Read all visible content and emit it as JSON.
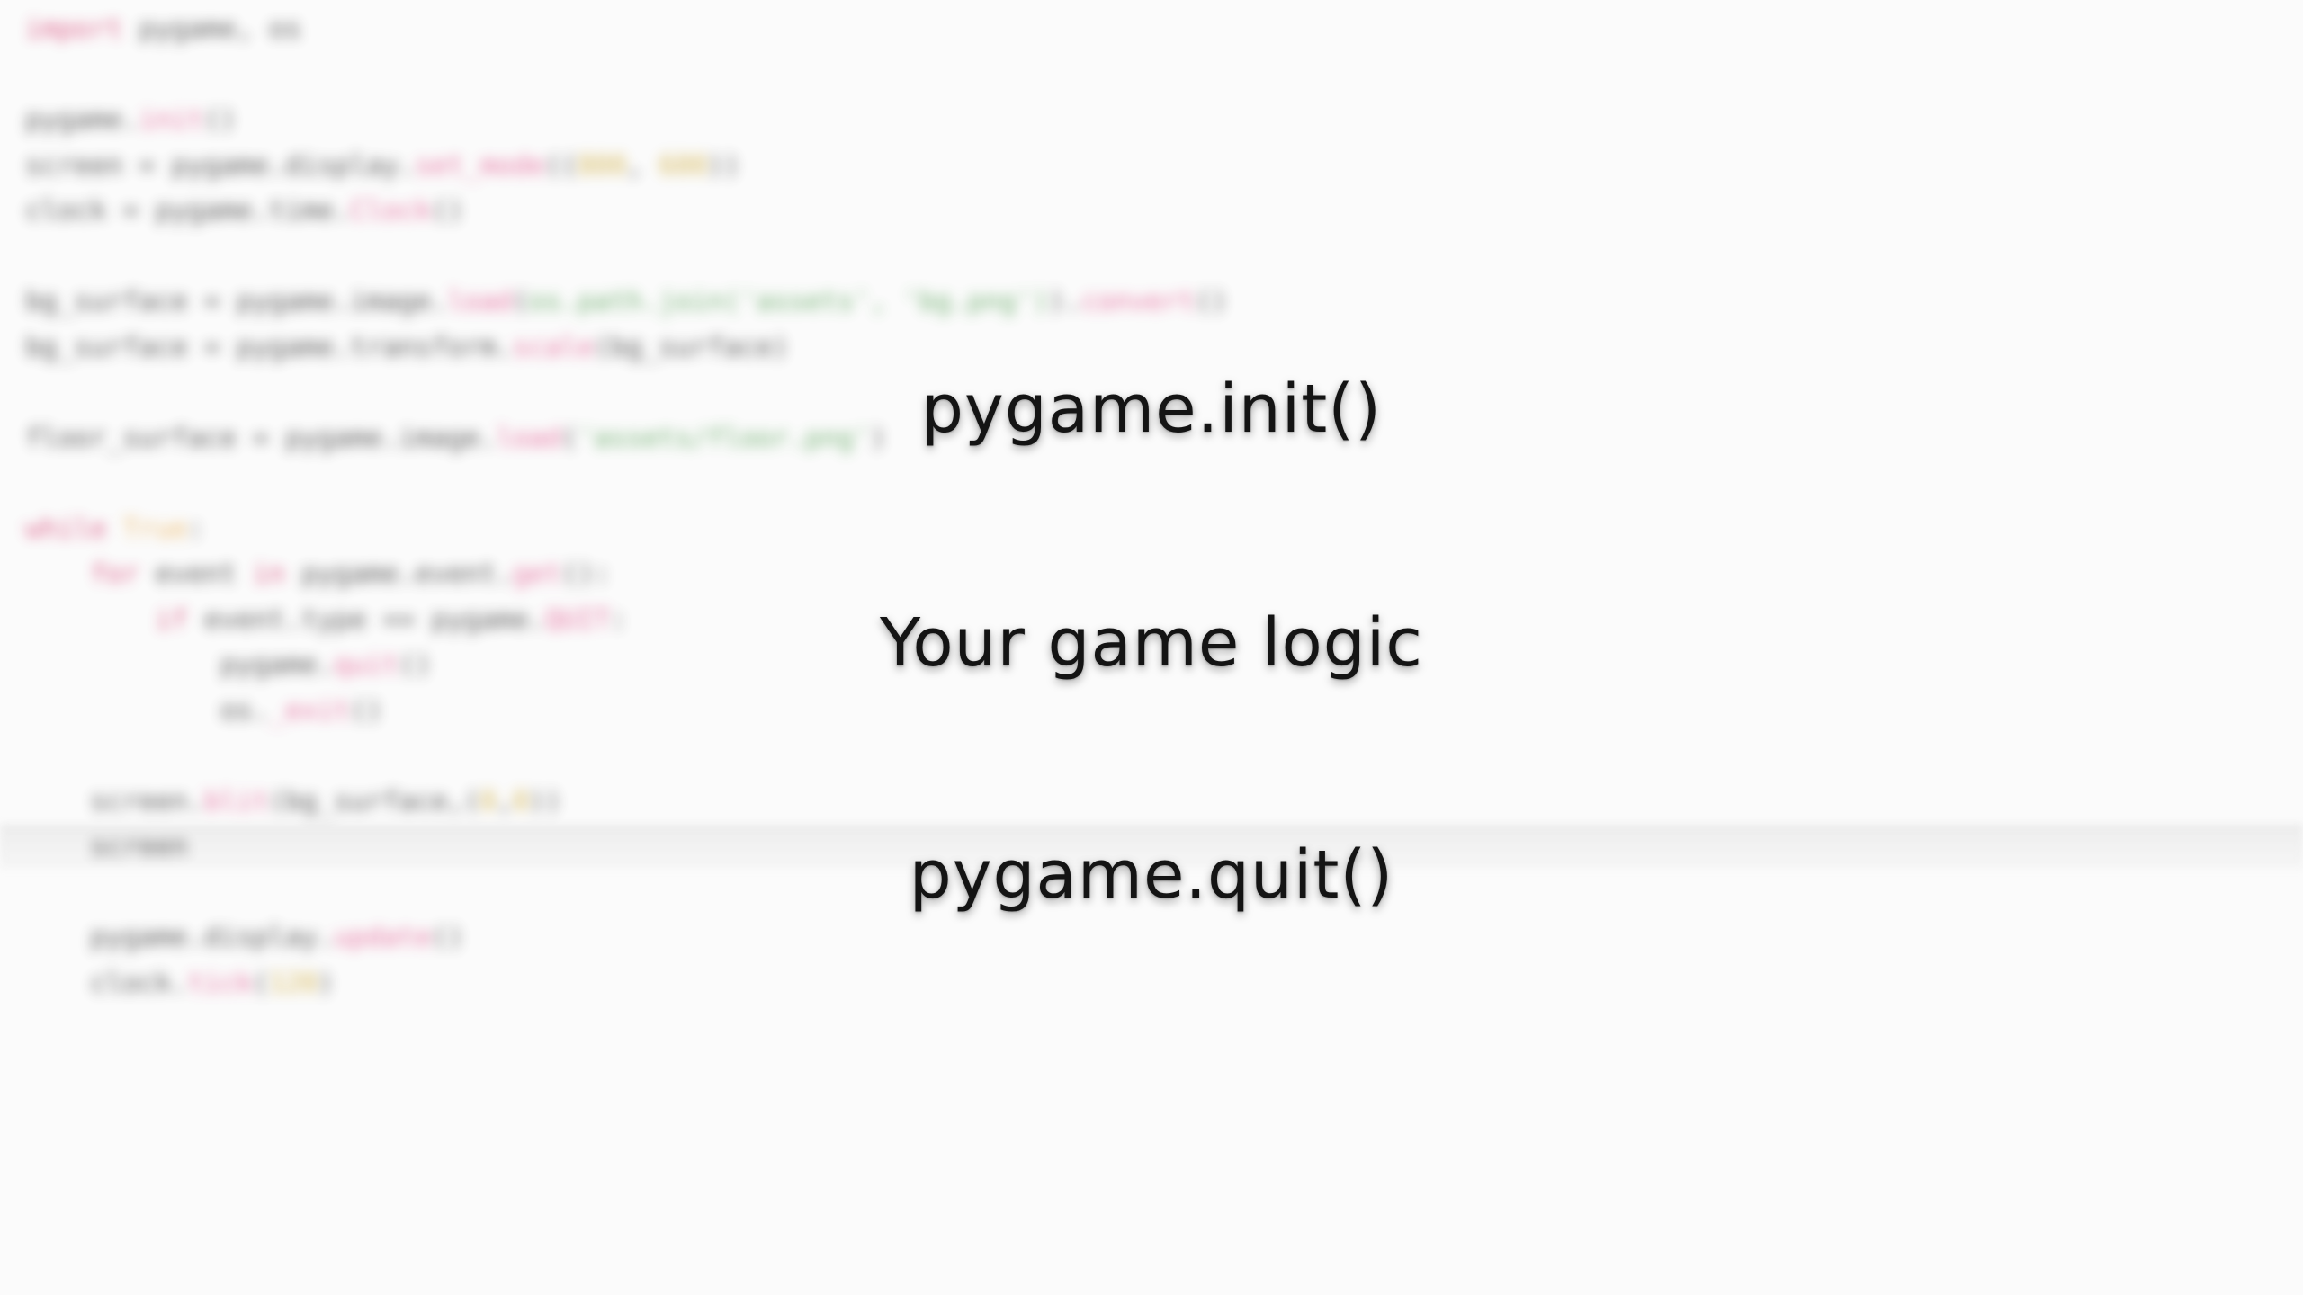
{
  "editor": {
    "lines": [
      [
        {
          "t": "import ",
          "c": "kw"
        },
        {
          "t": "pygame",
          "c": "fn"
        },
        {
          "t": ", os",
          "c": "fn"
        }
      ],
      [],
      [
        {
          "t": "pygame.",
          "c": "fn"
        },
        {
          "t": "init",
          "c": "pink"
        },
        {
          "t": "()",
          "c": "fn"
        }
      ],
      [
        {
          "t": "screen = pygame.display.",
          "c": "fn"
        },
        {
          "t": "set_mode",
          "c": "pink"
        },
        {
          "t": "((",
          "c": "fn"
        },
        {
          "t": "800",
          "c": "num"
        },
        {
          "t": ", ",
          "c": "fn"
        },
        {
          "t": "600",
          "c": "num"
        },
        {
          "t": "))",
          "c": "fn"
        }
      ],
      [
        {
          "t": "clock = pygame.time.",
          "c": "fn"
        },
        {
          "t": "Clock",
          "c": "pink"
        },
        {
          "t": "()",
          "c": "fn"
        }
      ],
      [],
      [
        {
          "t": "bg_surface = pygame.image.",
          "c": "fn"
        },
        {
          "t": "load",
          "c": "pink"
        },
        {
          "t": "(",
          "c": "fn"
        },
        {
          "t": "os.path.join('assets', 'bg.png')",
          "c": "str"
        },
        {
          "t": ").",
          "c": "fn"
        },
        {
          "t": "convert",
          "c": "pink"
        },
        {
          "t": "()",
          "c": "fn"
        }
      ],
      [
        {
          "t": "bg_surface = pygame.transform.",
          "c": "fn"
        },
        {
          "t": "scale",
          "c": "pink"
        },
        {
          "t": "(bg_surface)",
          "c": "fn"
        }
      ],
      [],
      [
        {
          "t": "floor_surface = pygame.image.",
          "c": "fn"
        },
        {
          "t": "load",
          "c": "pink"
        },
        {
          "t": "(",
          "c": "fn"
        },
        {
          "t": "'assets/floor.png'",
          "c": "str"
        },
        {
          "t": ")",
          "c": "fn"
        }
      ],
      [],
      [
        {
          "t": "while ",
          "c": "kw"
        },
        {
          "t": "True",
          "c": "orange"
        },
        {
          "t": ":",
          "c": "fn"
        }
      ],
      [
        {
          "t": "    for ",
          "c": "kw"
        },
        {
          "t": "event ",
          "c": "fn"
        },
        {
          "t": "in ",
          "c": "kw"
        },
        {
          "t": "pygame.event.",
          "c": "fn"
        },
        {
          "t": "get",
          "c": "pink"
        },
        {
          "t": "():",
          "c": "fn"
        }
      ],
      [
        {
          "t": "        if ",
          "c": "kw"
        },
        {
          "t": "event.type == pygame.",
          "c": "fn"
        },
        {
          "t": "QUIT",
          "c": "pink"
        },
        {
          "t": ":",
          "c": "fn"
        }
      ],
      [
        {
          "t": "            pygame.",
          "c": "fn"
        },
        {
          "t": "quit",
          "c": "pink"
        },
        {
          "t": "()",
          "c": "fn"
        }
      ],
      [
        {
          "t": "            os.",
          "c": "fn"
        },
        {
          "t": "_exit",
          "c": "pink"
        },
        {
          "t": "()",
          "c": "fn"
        }
      ],
      [],
      [
        {
          "t": "    screen.",
          "c": "fn"
        },
        {
          "t": "blit",
          "c": "pink"
        },
        {
          "t": "(bg_surface,(",
          "c": "fn"
        },
        {
          "t": "0",
          "c": "num"
        },
        {
          "t": ",",
          "c": "fn"
        },
        {
          "t": "0",
          "c": "num"
        },
        {
          "t": "))",
          "c": "fn"
        }
      ],
      [
        {
          "t": "    screen",
          "c": "fn"
        }
      ],
      [],
      [
        {
          "t": "    pygame.display.",
          "c": "fn"
        },
        {
          "t": "update",
          "c": "pink"
        },
        {
          "t": "()",
          "c": "fn"
        }
      ],
      [
        {
          "t": "    clock.",
          "c": "fn"
        },
        {
          "t": "tick",
          "c": "pink"
        },
        {
          "t": "(",
          "c": "fn"
        },
        {
          "t": "120",
          "c": "num"
        },
        {
          "t": ")",
          "c": "fn"
        }
      ]
    ]
  },
  "captions": {
    "init": "pygame.init()",
    "logic": "Your game logic",
    "quit": "pygame.quit()"
  }
}
